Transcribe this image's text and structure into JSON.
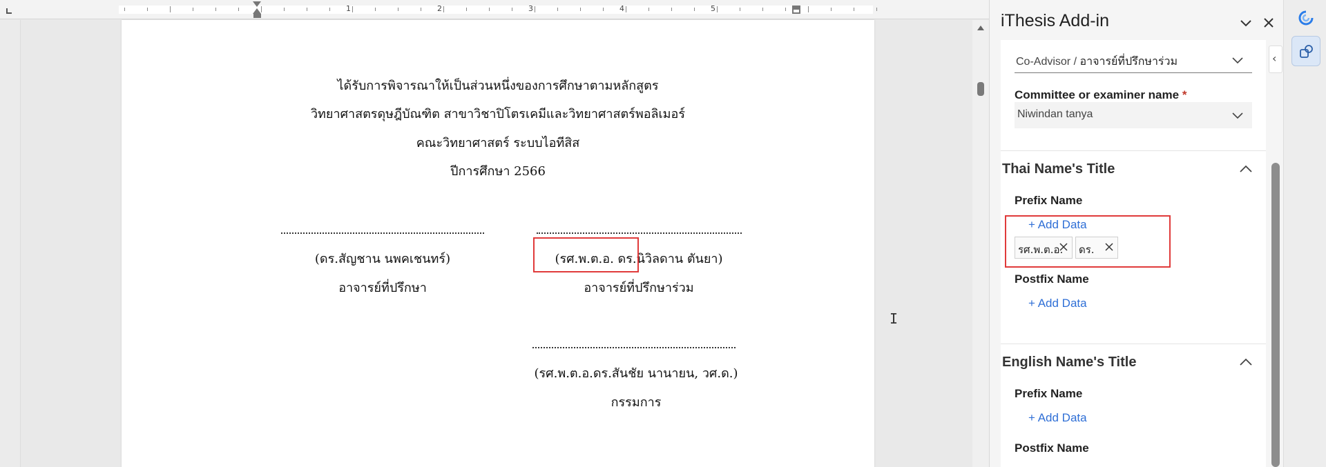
{
  "ruler": {
    "numbers": [
      "1",
      "2",
      "3",
      "4",
      "5"
    ]
  },
  "document": {
    "approval_lines": [
      "ได้รับการพิจารณาให้เป็นส่วนหนึ่งของการศึกษาตามหลักสูตร",
      "วิทยาศาสตรดุษฎีบัณฑิต สาขาวิชาปิโตรเคมีและวิทยาศาสตร์พอลิเมอร์",
      "คณะวิทยาศาสตร์ ระบบไอทีสิส",
      "ปีการศึกษา 2566"
    ],
    "signatures": {
      "advisor": {
        "name": "(ดร.สัญชาน นพคเชนทร์)",
        "role": "อาจารย์ที่ปรึกษา"
      },
      "co_advisor": {
        "name": "(รศ.พ.ต.อ. ดร.นิวิลดาน ตันยา)",
        "role": "อาจารย์ที่ปรึกษาร่วม"
      },
      "committee": {
        "name": "(รศ.พ.ต.อ.ดร.สันชัย นานายน, วศ.ด.)",
        "role": "กรรมการ"
      }
    }
  },
  "addin": {
    "title": "iThesis Add-in",
    "role_select": {
      "value_en": "Co-Advisor /",
      "value_th": "อาจารย์ที่ปรึกษาร่วม"
    },
    "committee_field": {
      "label": "Committee or examiner name",
      "required_mark": "*",
      "value": "Niwindan tanya"
    },
    "thai_section": {
      "title": "Thai Name's Title",
      "prefix_label": "Prefix Name",
      "add_label": "+ Add Data",
      "chips": [
        "รศ.พ.ต.อ.",
        "ดร."
      ],
      "postfix_label": "Postfix Name",
      "postfix_add_label": "+ Add Data"
    },
    "english_section": {
      "title": "English Name's Title",
      "prefix_label": "Prefix Name",
      "add_label": "+ Add Data",
      "postfix_label": "Postfix Name"
    }
  },
  "colors": {
    "highlight": "#e03a3a",
    "link": "#2f6fd6",
    "accent": "#dbe7f7"
  }
}
